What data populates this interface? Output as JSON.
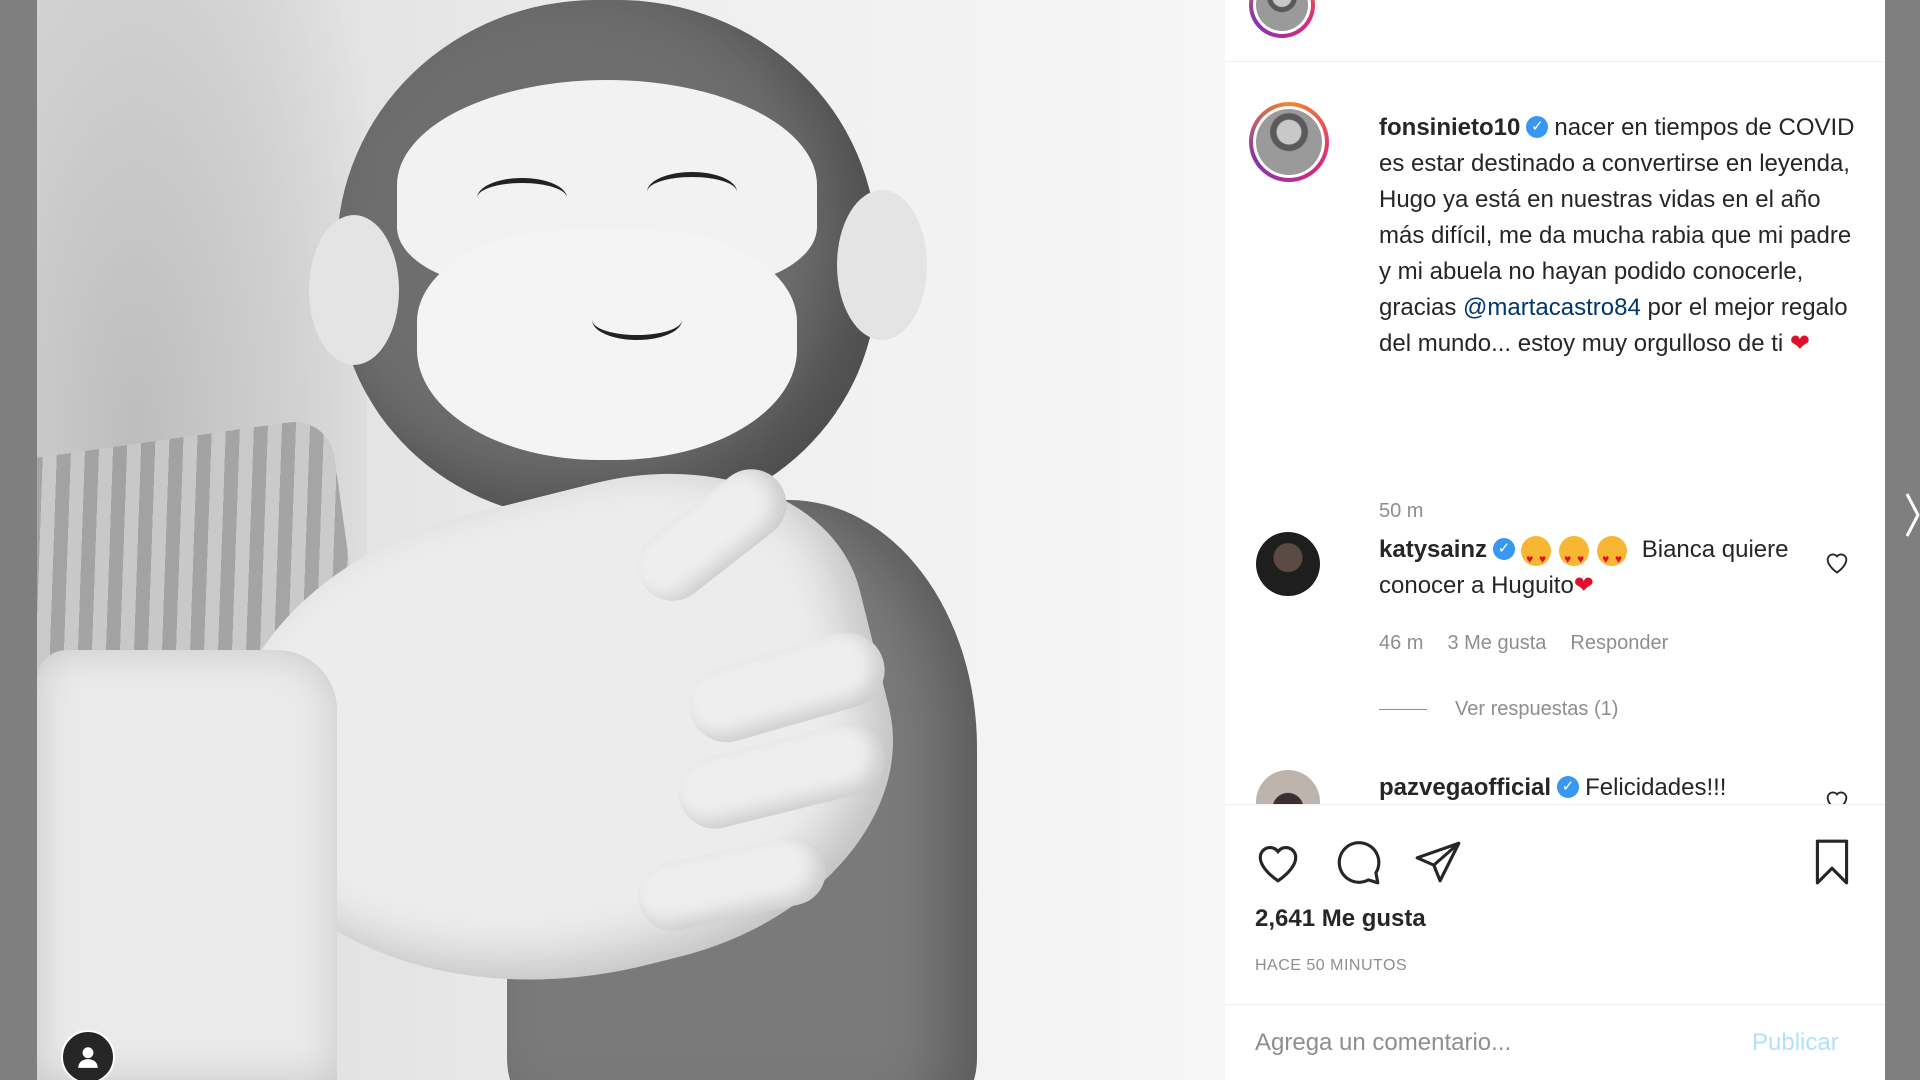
{
  "post": {
    "author": "fonsinieto10",
    "caption_text": "nacer en tiempos de COVID es estar destinado a convertirse en leyenda, Hugo ya está en nuestras vidas en el año más difícil, me da mucha rabia que mi padre y mi abuela no hayan podido conocerle, gracias ",
    "caption_mention": "@martacastro84",
    "caption_end": " por el mejor regalo del mundo... estoy muy orgulloso de ti ",
    "caption_time": "50 m"
  },
  "comments": [
    {
      "user": "katysainz",
      "text": " Bianca quiere conocer a Huguito",
      "time": "46 m",
      "likes": "3 Me gusta",
      "reply": "Responder",
      "view_replies": "Ver respuestas (1)"
    },
    {
      "user": "pazvegaofficial",
      "text": "Felicidades!!!"
    }
  ],
  "actions": {
    "likes_count": "2,641 Me gusta",
    "posted_ago": "HACE 50 MINUTOS"
  },
  "add_comment": {
    "placeholder": "Agrega un comentario...",
    "publish_label": "Publicar"
  },
  "colors": {
    "verified": "#3897f0",
    "mention": "#00376b",
    "heart": "#e0102b",
    "publish_disabled": "#b2dffc"
  }
}
